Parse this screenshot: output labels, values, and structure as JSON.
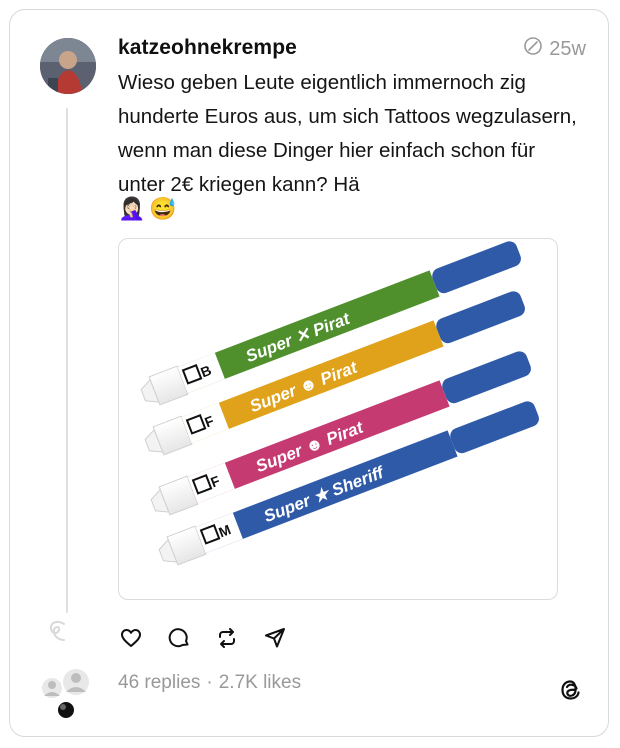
{
  "post": {
    "username": "katzeohnekrempe",
    "time": "25w",
    "text": "Wieso geben Leute eigentlich immernoch zig hunderte Euros aus, um sich Tattoos wegzulasern, wenn man diese Dinger hier einfach schon für unter 2€ kriegen kann? Hä",
    "emojis": [
      "🤦🏻‍♀️",
      "😅"
    ]
  },
  "media": {
    "markers": [
      {
        "name": "Super Pirat",
        "nib": "B",
        "color": "#4f8f2c"
      },
      {
        "name": "Super Pirat",
        "nib": "F",
        "color": "#e0a21a"
      },
      {
        "name": "Super Pirat",
        "nib": "F",
        "color": "#c63a72"
      },
      {
        "name": "Super Sheriff",
        "nib": "M",
        "color": "#2f5aa8"
      }
    ]
  },
  "stats": {
    "replies": "46 replies",
    "separator": "·",
    "likes": "2.7K likes"
  },
  "icons": [
    "like-icon",
    "comment-icon",
    "repost-icon",
    "share-icon",
    "threads-logo-icon",
    "edited-icon"
  ]
}
